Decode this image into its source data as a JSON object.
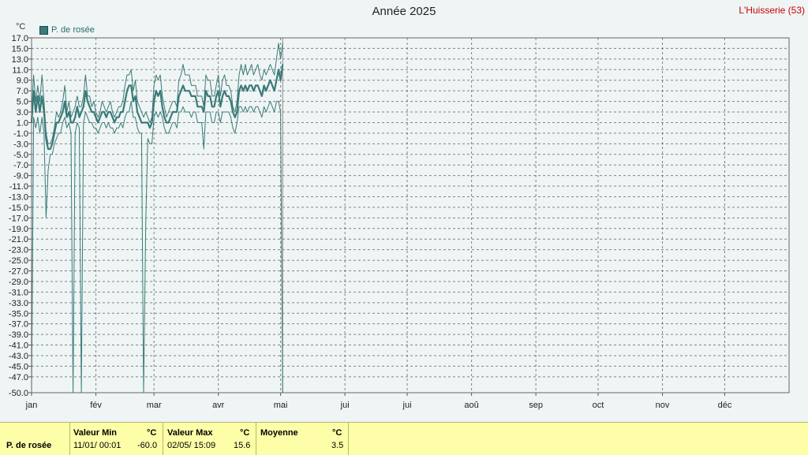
{
  "title": "Année 2025",
  "station": "L'Huisserie (53)",
  "unit": "°C",
  "legend_label": "P. de rosée",
  "colors": {
    "series": "#3a7a79",
    "background": "#eef5f4",
    "footer": "#fefea8"
  },
  "chart_data": {
    "type": "line",
    "title": "Année 2025",
    "ylabel": "°C",
    "ylim": [
      -50,
      17
    ],
    "yticks": [
      "17.0",
      "15.0",
      "13.0",
      "11.0",
      "9.0",
      "7.0",
      "5.0",
      "3.0",
      "1.0",
      "-1.0",
      "-3.0",
      "-5.0",
      "-7.0",
      "-9.0",
      "-11.0",
      "-13.0",
      "-15.0",
      "-17.0",
      "-19.0",
      "-21.0",
      "-23.0",
      "-25.0",
      "-27.0",
      "-29.0",
      "-31.0",
      "-33.0",
      "-35.0",
      "-37.0",
      "-39.0",
      "-41.0",
      "-43.0",
      "-45.0",
      "-47.0",
      "-50.0"
    ],
    "months": [
      "jan",
      "fév",
      "mar",
      "avr",
      "mai",
      "jui",
      "jui",
      "aoû",
      "sep",
      "oct",
      "nov",
      "déc"
    ],
    "grid": true,
    "legend": "top-left",
    "x_day_of_year": [
      1,
      2,
      3,
      4,
      5,
      6,
      7,
      8,
      9,
      10,
      11,
      12,
      13,
      14,
      15,
      16,
      17,
      18,
      19,
      20,
      21,
      22,
      23,
      24,
      25,
      26,
      27,
      28,
      29,
      30,
      31,
      32,
      33,
      34,
      35,
      36,
      37,
      38,
      39,
      40,
      41,
      42,
      43,
      44,
      45,
      46,
      47,
      48,
      49,
      50,
      51,
      52,
      53,
      54,
      55,
      56,
      57,
      58,
      59,
      60,
      61,
      62,
      63,
      64,
      65,
      66,
      67,
      68,
      69,
      70,
      71,
      72,
      73,
      74,
      75,
      76,
      77,
      78,
      79,
      80,
      81,
      82,
      83,
      84,
      85,
      86,
      87,
      88,
      89,
      90,
      91,
      92,
      93,
      94,
      95,
      96,
      97,
      98,
      99,
      100,
      101,
      102,
      103,
      104,
      105,
      106,
      107,
      108,
      109,
      110,
      111,
      112,
      113,
      114,
      115,
      116,
      117,
      118,
      119,
      120,
      121,
      122
    ],
    "series": [
      {
        "name": "P. de rosée",
        "max": [
          2,
          10,
          5,
          8,
          5,
          10,
          5,
          -1,
          -3,
          -3,
          -2,
          0,
          3,
          2,
          3,
          5,
          8,
          3,
          5,
          2,
          3,
          4,
          6,
          4,
          4,
          6,
          10,
          6,
          6,
          4,
          5,
          3,
          2,
          3,
          5,
          4,
          3,
          4,
          5,
          3,
          2,
          3,
          4,
          4,
          5,
          8,
          10,
          10,
          11,
          7,
          9,
          5,
          4,
          3,
          2,
          3,
          2,
          1,
          2,
          8,
          10,
          9,
          10,
          6,
          4,
          2,
          3,
          4,
          5,
          5,
          4,
          9,
          10,
          12,
          10,
          10,
          10,
          8,
          8,
          8,
          6,
          6,
          6,
          4,
          10,
          9,
          9,
          6,
          6,
          8,
          10,
          6,
          9,
          10,
          8,
          8,
          7,
          4,
          3,
          5,
          10,
          12,
          10,
          12,
          10,
          11,
          12,
          10,
          11,
          12,
          10,
          9,
          11,
          10,
          11,
          12,
          11,
          10,
          13,
          16,
          13,
          16
        ],
        "mean": [
          1,
          7,
          3,
          6,
          3,
          6,
          3,
          -2,
          -4,
          -4,
          -3,
          -1,
          1,
          1,
          2,
          3,
          5,
          2,
          3,
          1,
          1,
          2,
          4,
          2,
          3,
          4,
          7,
          5,
          4,
          3,
          3,
          2,
          1,
          2,
          3,
          3,
          2,
          3,
          3,
          2,
          1,
          2,
          2,
          3,
          3,
          5,
          7,
          8,
          8,
          5,
          6,
          3,
          2,
          1,
          1,
          1,
          1,
          0,
          1,
          5,
          7,
          6,
          7,
          4,
          2,
          1,
          1,
          2,
          3,
          3,
          3,
          6,
          7,
          8,
          7,
          7,
          7,
          6,
          6,
          6,
          4,
          4,
          4,
          3,
          7,
          6,
          6,
          4,
          4,
          6,
          7,
          4,
          6,
          7,
          6,
          6,
          5,
          3,
          2,
          3,
          7,
          8,
          7,
          8,
          7,
          8,
          8,
          7,
          8,
          8,
          7,
          6,
          8,
          7,
          8,
          9,
          8,
          7,
          9,
          11,
          9,
          12
        ],
        "min": [
          -50,
          2,
          0,
          2,
          -1,
          2,
          -1,
          -17,
          -8,
          -5,
          -5,
          -3,
          -2,
          -1,
          -1,
          1,
          2,
          0,
          1,
          -1,
          -50,
          -1,
          1,
          0,
          -50,
          1,
          3,
          2,
          1,
          1,
          0,
          0,
          -1,
          0,
          1,
          1,
          0,
          1,
          0,
          0,
          -1,
          0,
          0,
          1,
          0,
          2,
          3,
          3,
          5,
          2,
          2,
          0,
          -1,
          -1,
          -50,
          -18,
          -2,
          -3,
          -3,
          2,
          3,
          2,
          3,
          2,
          0,
          -1,
          -1,
          0,
          1,
          1,
          0,
          3,
          3,
          4,
          3,
          3,
          3,
          2,
          3,
          3,
          1,
          1,
          1,
          -4,
          3,
          3,
          3,
          1,
          1,
          3,
          3,
          1,
          3,
          3,
          3,
          3,
          2,
          0,
          -1,
          1,
          4,
          4,
          3,
          4,
          3,
          4,
          4,
          3,
          4,
          4,
          3,
          2,
          4,
          3,
          4,
          5,
          4,
          3,
          5,
          5,
          3,
          -50
        ]
      }
    ]
  },
  "footer": {
    "series_label": "P. de rosée",
    "min_header": "Valeur Min",
    "max_header": "Valeur Max",
    "mean_header": "Moyenne",
    "unit": "°C",
    "min_date": "11/01/  00:01",
    "min_value": "-60.0",
    "max_date": "02/05/  15:09",
    "max_value": "15.6",
    "mean_value": "3.5"
  }
}
